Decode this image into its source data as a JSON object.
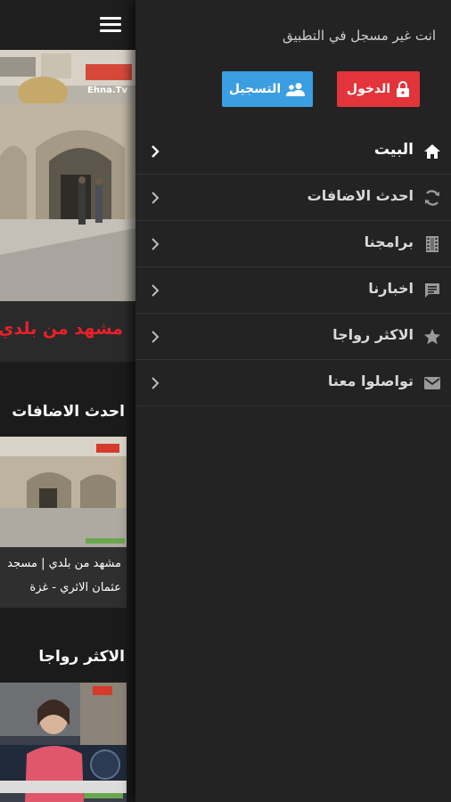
{
  "background_page": {
    "hero_caption": "مشهد من بلدي",
    "latest_heading": "احدث الاضافات",
    "card1_line1": "مشهد من بلدي | مسجد",
    "card1_line2": "عثمان الاثري - غزة",
    "popular_heading": "الاكثر رواجا",
    "watermark": "Ehna.Tv"
  },
  "drawer": {
    "guest_notice": "انت غير مسجل في التطبيق",
    "login_label": "الدخول",
    "register_label": "التسجيل",
    "nav_items": [
      {
        "label": "البيت",
        "icon": "home-icon",
        "active": true
      },
      {
        "label": "احدث الاضافات",
        "icon": "refresh-icon",
        "active": false
      },
      {
        "label": "برامجنا",
        "icon": "film-icon",
        "active": false
      },
      {
        "label": "اخبارنا",
        "icon": "chat-icon",
        "active": false
      },
      {
        "label": "الاكثر رواجا",
        "icon": "star-icon",
        "active": false
      },
      {
        "label": "تواصلوا معنا",
        "icon": "mail-icon",
        "active": false
      }
    ]
  },
  "colors": {
    "login": "#e2343a",
    "register": "#3b9ee0",
    "drawer_bg": "#232323",
    "accent_red": "#e8202a"
  }
}
